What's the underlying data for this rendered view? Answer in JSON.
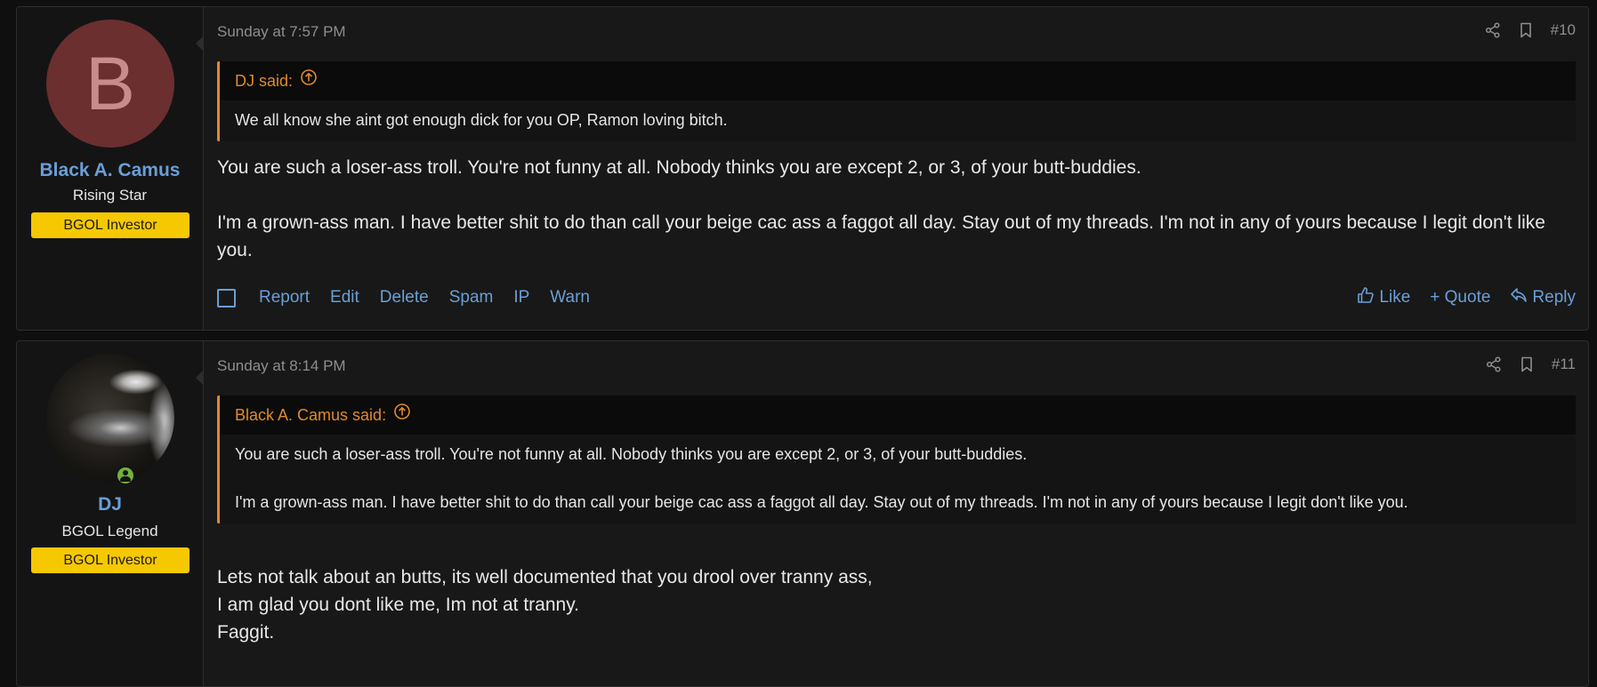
{
  "posts": [
    {
      "avatar_letter": "B",
      "username": "Black A. Camus",
      "user_title": "Rising Star",
      "banner": "BGOL Investor",
      "date": "Sunday at 7:57 PM",
      "post_number": "#10",
      "quote": {
        "author": "DJ said:",
        "paragraphs": [
          "We all know she aint got enough dick for you OP, Ramon loving bitch."
        ]
      },
      "message": [
        "You are such a loser-ass troll. You're not funny at all. Nobody thinks you are except 2, or 3, of your butt-buddies.",
        "I'm a grown-ass man. I have better shit to do than call your beige cac ass a faggot all day. Stay out of my threads. I'm not in any of yours because I legit don't like you."
      ],
      "actions": [
        "Report",
        "Edit",
        "Delete",
        "Spam",
        "IP",
        "Warn"
      ],
      "reactions": {
        "like": "Like",
        "quote": "+ Quote",
        "reply": "Reply"
      }
    },
    {
      "username": "DJ",
      "user_title": "BGOL Legend",
      "banner": "BGOL Investor",
      "date": "Sunday at 8:14 PM",
      "post_number": "#11",
      "quote": {
        "author": "Black A. Camus said:",
        "paragraphs": [
          "You are such a loser-ass troll. You're not funny at all. Nobody thinks you are except 2, or 3, of your butt-buddies.",
          "I'm a grown-ass man. I have better shit to do than call your beige cac ass a faggot all day. Stay out of my threads. I'm not in any of yours because I legit don't like you."
        ]
      },
      "message": [
        "Lets not talk about an butts, its well documented that you drool over tranny ass,",
        "I am glad you dont like me, Im not at tranny.",
        "Faggit."
      ]
    }
  ],
  "colors": {
    "link": "#6a9fd8",
    "quote_accent": "#e08a2c",
    "banner": "#f6c800",
    "online": "#73b23a"
  }
}
